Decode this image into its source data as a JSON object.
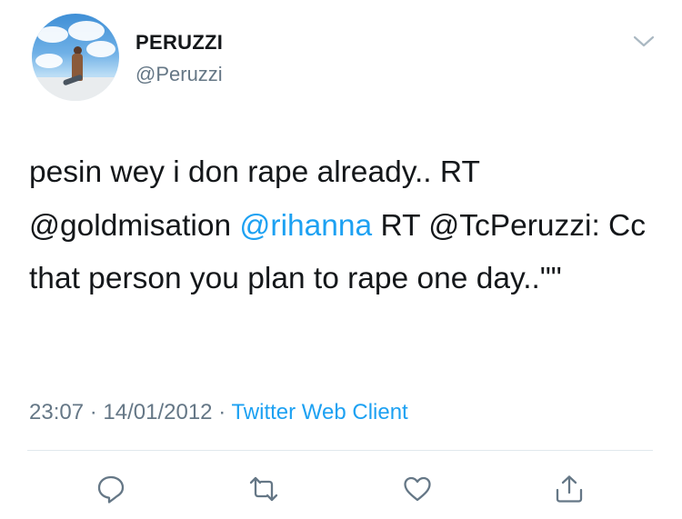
{
  "user": {
    "display_name": "PERUZZI",
    "handle": "@Peruzzi",
    "avatar": "profile-photo"
  },
  "tweet": {
    "text_segments": [
      {
        "text": "pesin wey i don rape already.. RT @goldmisation ",
        "type": "text"
      },
      {
        "text": "@rihanna",
        "type": "mention"
      },
      {
        "text": " RT @TcPeruzzi: Cc that person you plan to rape one day..\"\"",
        "type": "text"
      }
    ],
    "time": "23:07",
    "separator": "·",
    "date": "14/01/2012",
    "source": "Twitter Web Client"
  },
  "actions": [
    {
      "name": "reply",
      "icon": "comment-icon"
    },
    {
      "name": "retweet",
      "icon": "retweet-icon"
    },
    {
      "name": "like",
      "icon": "heart-icon"
    },
    {
      "name": "share",
      "icon": "share-icon"
    }
  ],
  "colors": {
    "text": "#14171a",
    "secondary": "#657786",
    "link": "#1da1f2",
    "divider": "#e1e8ed"
  }
}
